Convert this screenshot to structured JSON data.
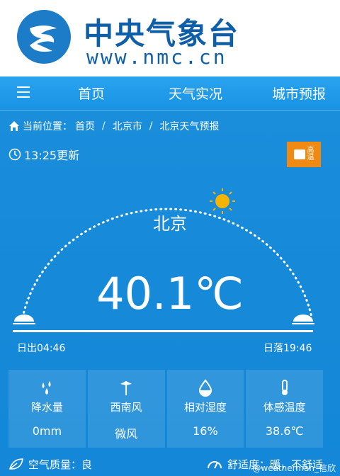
{
  "site": {
    "name": "中央气象台",
    "url": "www.nmc.cn"
  },
  "nav": {
    "home": "首页",
    "live": "天气实况",
    "forecast": "城市预报"
  },
  "breadcrumb": {
    "label": "当前位置：",
    "items": [
      "首页",
      "北京市",
      "北京天气预报"
    ]
  },
  "update": {
    "time": "13:25更新"
  },
  "alert": {
    "level_text": "高",
    "sub_text": "温"
  },
  "weather": {
    "city": "北京",
    "temperature": "40.1℃",
    "sunrise": "日出04:46",
    "sunset": "日落19:46"
  },
  "stats": [
    {
      "label": "降水量",
      "value": "0mm",
      "icon": "drops-icon"
    },
    {
      "label": "西南风",
      "value": "微风",
      "icon": "wind-icon"
    },
    {
      "label": "相对湿度",
      "value": "16%",
      "icon": "drop-icon"
    },
    {
      "label": "体感温度",
      "value": "38.6℃",
      "icon": "thermometer-icon"
    }
  ],
  "bottom": {
    "air_quality": "空气质量：良",
    "comfort": "舒适度：暖，不舒适"
  },
  "watermark": "@weatherman_信欣",
  "colors": {
    "brand": "#0f5fa8",
    "bg": "#1a8fd9",
    "alert": "#f08a12",
    "sun": "#f5b400"
  }
}
